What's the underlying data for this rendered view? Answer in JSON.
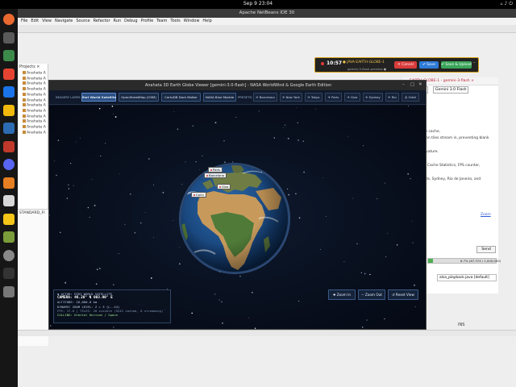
{
  "topbar": {
    "clock": "Sep 9  23:04"
  },
  "dock": {
    "items": [
      {
        "name": "firefox-icon",
        "color": "#e8692f"
      },
      {
        "name": "files-icon",
        "color": "#5a5a5a"
      },
      {
        "name": "chrome-icon",
        "color": "#3b8a4a"
      },
      {
        "name": "anydesk-icon",
        "color": "#e44332"
      },
      {
        "name": "teamviewer-icon",
        "color": "#1a73e8"
      },
      {
        "name": "binance-icon",
        "color": "#f0b90b"
      },
      {
        "name": "netbeans-icon",
        "color": "#2d6bb2"
      },
      {
        "name": "app-red-icon",
        "color": "#c0392b"
      },
      {
        "name": "discord-icon",
        "color": "#5865f2"
      },
      {
        "name": "vlc-icon",
        "color": "#e67e22"
      },
      {
        "name": "search-icon",
        "color": "#d8d8d8"
      },
      {
        "name": "notes-icon",
        "color": "#f5c518"
      },
      {
        "name": "editor-icon",
        "color": "#7b9c3a"
      },
      {
        "name": "trash-icon",
        "color": "#888888"
      },
      {
        "name": "terminal-icon",
        "color": "#333333"
      },
      {
        "name": "settings-icon",
        "color": "#777777"
      }
    ]
  },
  "ide": {
    "title": "Apache NetBeans IDE 30",
    "menu": [
      "File",
      "Edit",
      "View",
      "Navigate",
      "Source",
      "Refactor",
      "Run",
      "Debug",
      "Profile",
      "Team",
      "Tools",
      "Window",
      "Help"
    ],
    "projects_label": "Projects ×",
    "project_rows": [
      "Anahata A",
      "Anahata A",
      "Anahata A",
      "Anahata A",
      "Anahata A",
      "Anahata A",
      "Anahata A",
      "Anahata A",
      "Anahata A",
      "Anahata A",
      "Anahata A",
      "Anahata A"
    ],
    "navigator_label": "STANDARD_FI",
    "status_ins": "INS",
    "right_panel": {
      "tab": "EARTH-GLOBE-1 - gemini-3-flash ×",
      "select1": "Clou...",
      "select2": "Gemini 3.0 Flash",
      "lines": [
        "ter-tiles-tile cache,",
        "gh resolution tiles stream in, preventing blank",
        "",
        "herical curvature.",
        "",
        "Tile Count, Cache Statistics, FPS counter,",
        "",
        "iza Pyramids, Sydney, Rio de Janeiro, and"
      ],
      "zoom_link": "Zoom",
      "send": "Send",
      "progress_text": "6.7% (67,374 / 1,000,000)",
      "progress_fraction": 0.067,
      "file": "alsa_playback.java [default]"
    }
  },
  "recorder": {
    "time": "10:57",
    "tag": "● JAVA-EARTH-GLOBE-1",
    "sub": "gemini-3-flash-preview ●",
    "buttons": {
      "cancel": "✕ Cancel",
      "save": "✔ Save",
      "upload": "✔ Save & Upload"
    },
    "minimize": "–"
  },
  "viewer": {
    "title": "Anahata 3D Earth Globe Viewer [gemini-3.0-flash] - NASA WorldWind & Google Earth Edition",
    "imagery_label": "IMAGERY LAYER:",
    "layers": [
      "Esri World Satellite",
      "OpenStreetMap (OSM)",
      "CartoDB Dark Matter",
      "NASA Blue Marble"
    ],
    "presets_label": "PRESETS:",
    "presets": [
      "✈ Barcelona",
      "✈ New York",
      "✈ Tokyo",
      "✈ Paris",
      "✈ Giza",
      "✈ Sydney",
      "✈ Rio",
      "◎ Orbit"
    ],
    "cities": [
      "Paris",
      "Barcelona",
      "Giza",
      "Cairo"
    ],
    "hud": {
      "actor": "◆ ACTOR: ESRI WORLD SATELLITE",
      "camera": "CAMERA: 46.20° N  003.90° E",
      "altitude": "ALTITUDE: 20,000.0 km",
      "zoom": "DYNAMIC ZOOM LEVEL: Z = 3 (L..14)",
      "fps": "FPS: 17.0 | TILES: 20 visible (9242 cached, 0 streaming)",
      "culling": "CULLING: Orbital Horizon / Space"
    },
    "buttons": {
      "zoom_in": "✚ Zoom In",
      "zoom_out": "− Zoom Out",
      "reset": "↺ Reset View"
    }
  }
}
